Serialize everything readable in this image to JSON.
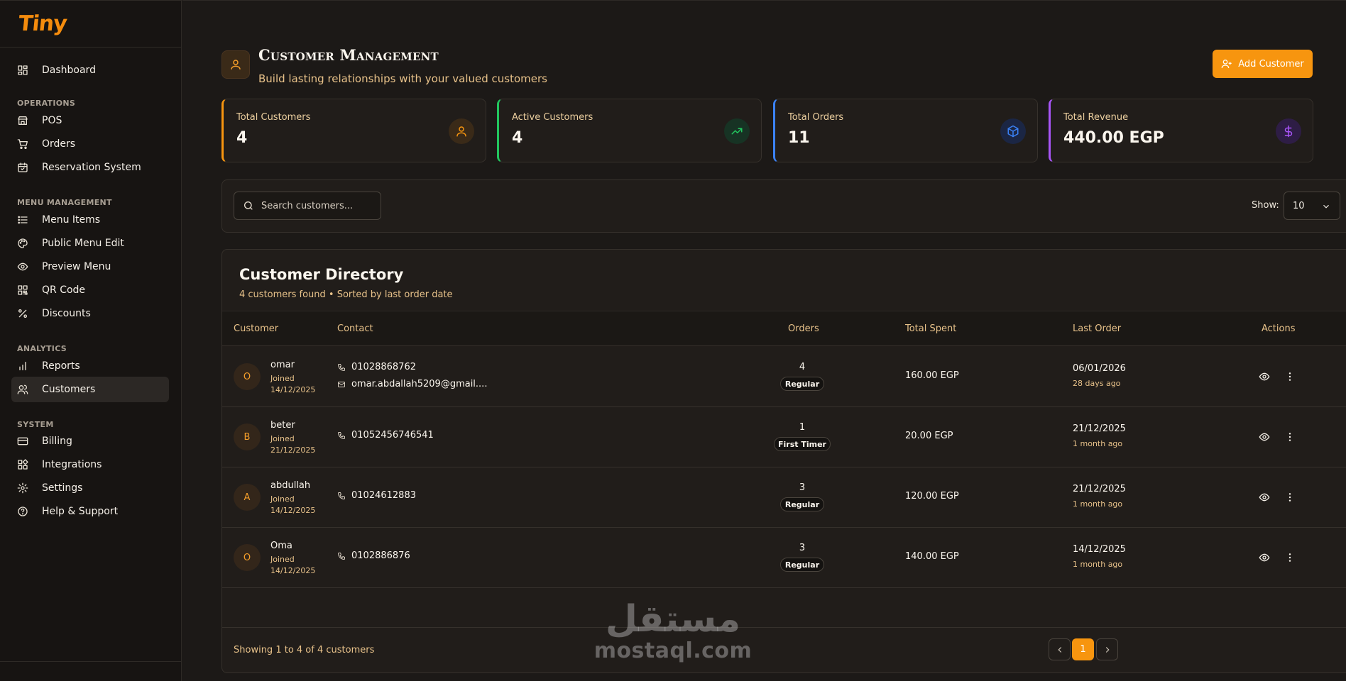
{
  "brand": {
    "logo_text": "Tiny",
    "accent": "#f7950f"
  },
  "sidebar": {
    "items": [
      {
        "label": "Dashboard",
        "icon": "dashboard-icon"
      },
      {
        "section": "OPERATIONS"
      },
      {
        "label": "POS",
        "icon": "store-icon"
      },
      {
        "label": "Orders",
        "icon": "cart-icon"
      },
      {
        "label": "Reservation System",
        "icon": "calendar-icon"
      },
      {
        "section": "MENU MANAGEMENT"
      },
      {
        "label": "Menu Items",
        "icon": "list-icon"
      },
      {
        "label": "Public Menu Edit",
        "icon": "palette-icon"
      },
      {
        "label": "Preview Menu",
        "icon": "eye-icon"
      },
      {
        "label": "QR Code",
        "icon": "qr-code-icon"
      },
      {
        "label": "Discounts",
        "icon": "percent-icon"
      },
      {
        "section": "ANALYTICS"
      },
      {
        "label": "Reports",
        "icon": "bar-chart-icon"
      },
      {
        "label": "Customers",
        "icon": "users-icon",
        "active": true
      },
      {
        "section": "SYSTEM"
      },
      {
        "label": "Billing",
        "icon": "credit-card-icon"
      },
      {
        "label": "Integrations",
        "icon": "integrations-icon"
      },
      {
        "label": "Settings",
        "icon": "gear-icon"
      },
      {
        "label": "Help & Support",
        "icon": "help-icon"
      }
    ]
  },
  "header": {
    "title": "Customer Management",
    "subtitle": "Build lasting relationships with your valued customers",
    "add_button": "Add Customer"
  },
  "stats": [
    {
      "label": "Total Customers",
      "value": "4",
      "color": "#f7950f",
      "icon": "user-icon"
    },
    {
      "label": "Active Customers",
      "value": "4",
      "color": "#22c55e",
      "icon": "trending-up-icon"
    },
    {
      "label": "Total Orders",
      "value": "11",
      "color": "#3b82f6",
      "icon": "box-icon"
    },
    {
      "label": "Total Revenue",
      "value": "440.00 EGP",
      "color": "#a855f7",
      "icon": "dollar-icon"
    }
  ],
  "filters": {
    "search_placeholder": "Search customers...",
    "show_label": "Show:",
    "show_value": "10"
  },
  "directory": {
    "title": "Customer Directory",
    "subtitle": "4 customers found • Sorted by last order date",
    "columns": [
      "Customer",
      "Contact",
      "Orders",
      "Total Spent",
      "Last Order",
      "Actions"
    ],
    "rows": [
      {
        "initial": "O",
        "name": "omar",
        "joined_label": "Joined",
        "joined_date": "14/12/2025",
        "phone": "01028868762",
        "email": "omar.abdallah5209@gmail....",
        "orders": "4",
        "badge": "Regular",
        "spent": "160.00 EGP",
        "last_order": "06/01/2026",
        "last_ago": "28 days ago"
      },
      {
        "initial": "B",
        "name": "beter",
        "joined_label": "Joined",
        "joined_date": "21/12/2025",
        "phone": "01052456746541",
        "email": null,
        "orders": "1",
        "badge": "First Timer",
        "spent": "20.00 EGP",
        "last_order": "21/12/2025",
        "last_ago": "1 month ago"
      },
      {
        "initial": "A",
        "name": "abdullah",
        "joined_label": "Joined",
        "joined_date": "14/12/2025",
        "phone": "01024612883",
        "email": null,
        "orders": "3",
        "badge": "Regular",
        "spent": "120.00 EGP",
        "last_order": "21/12/2025",
        "last_ago": "1 month ago"
      },
      {
        "initial": "O",
        "name": "Oma",
        "joined_label": "Joined",
        "joined_date": "14/12/2025",
        "phone": "0102886876",
        "email": null,
        "orders": "3",
        "badge": "Regular",
        "spent": "140.00 EGP",
        "last_order": "14/12/2025",
        "last_ago": "1 month ago"
      }
    ],
    "footer": "Showing 1 to 4 of 4 customers",
    "current_page": "1"
  },
  "watermark": {
    "arabic": "مستقل",
    "latin": "mostaql.com"
  }
}
